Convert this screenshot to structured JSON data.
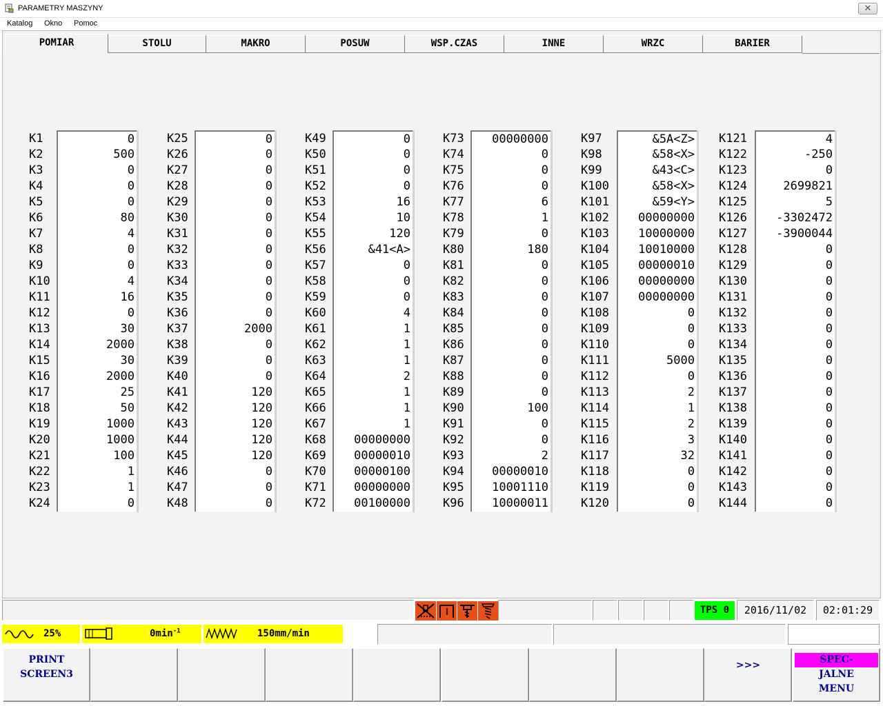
{
  "window": {
    "title": "PARAMETRY MASZYNY",
    "close_label": "✕"
  },
  "menu": [
    "Katalog",
    "Okno",
    "Pomoc"
  ],
  "tabs": [
    "POMIAR",
    "STOLU",
    "MAKRO",
    "POSUW",
    "WSP.CZAS",
    "INNE",
    "WRZC",
    "BARIER"
  ],
  "active_tab": "POMIAR",
  "params": [
    [
      {
        "k": "K1",
        "v": "0"
      },
      {
        "k": "K2",
        "v": "500"
      },
      {
        "k": "K3",
        "v": "0"
      },
      {
        "k": "K4",
        "v": "0"
      },
      {
        "k": "K5",
        "v": "0"
      },
      {
        "k": "K6",
        "v": "80"
      },
      {
        "k": "K7",
        "v": "4"
      },
      {
        "k": "K8",
        "v": "0"
      },
      {
        "k": "K9",
        "v": "0"
      },
      {
        "k": "K10",
        "v": "4"
      },
      {
        "k": "K11",
        "v": "16"
      },
      {
        "k": "K12",
        "v": "0"
      },
      {
        "k": "K13",
        "v": "30"
      },
      {
        "k": "K14",
        "v": "2000"
      },
      {
        "k": "K15",
        "v": "30"
      },
      {
        "k": "K16",
        "v": "2000"
      },
      {
        "k": "K17",
        "v": "25"
      },
      {
        "k": "K18",
        "v": "50"
      },
      {
        "k": "K19",
        "v": "1000"
      },
      {
        "k": "K20",
        "v": "1000"
      },
      {
        "k": "K21",
        "v": "100"
      },
      {
        "k": "K22",
        "v": "1"
      },
      {
        "k": "K23",
        "v": "1"
      },
      {
        "k": "K24",
        "v": "0"
      }
    ],
    [
      {
        "k": "K25",
        "v": "0"
      },
      {
        "k": "K26",
        "v": "0"
      },
      {
        "k": "K27",
        "v": "0"
      },
      {
        "k": "K28",
        "v": "0"
      },
      {
        "k": "K29",
        "v": "0"
      },
      {
        "k": "K30",
        "v": "0"
      },
      {
        "k": "K31",
        "v": "0"
      },
      {
        "k": "K32",
        "v": "0"
      },
      {
        "k": "K33",
        "v": "0"
      },
      {
        "k": "K34",
        "v": "0"
      },
      {
        "k": "K35",
        "v": "0"
      },
      {
        "k": "K36",
        "v": "0"
      },
      {
        "k": "K37",
        "v": "2000"
      },
      {
        "k": "K38",
        "v": "0"
      },
      {
        "k": "K39",
        "v": "0"
      },
      {
        "k": "K40",
        "v": "0"
      },
      {
        "k": "K41",
        "v": "120"
      },
      {
        "k": "K42",
        "v": "120"
      },
      {
        "k": "K43",
        "v": "120"
      },
      {
        "k": "K44",
        "v": "120"
      },
      {
        "k": "K45",
        "v": "120"
      },
      {
        "k": "K46",
        "v": "0"
      },
      {
        "k": "K47",
        "v": "0"
      },
      {
        "k": "K48",
        "v": "0"
      }
    ],
    [
      {
        "k": "K49",
        "v": "0"
      },
      {
        "k": "K50",
        "v": "0"
      },
      {
        "k": "K51",
        "v": "0"
      },
      {
        "k": "K52",
        "v": "0"
      },
      {
        "k": "K53",
        "v": "16"
      },
      {
        "k": "K54",
        "v": "10"
      },
      {
        "k": "K55",
        "v": "120"
      },
      {
        "k": "K56",
        "v": "&41<A>"
      },
      {
        "k": "K57",
        "v": "0"
      },
      {
        "k": "K58",
        "v": "0"
      },
      {
        "k": "K59",
        "v": "0"
      },
      {
        "k": "K60",
        "v": "4"
      },
      {
        "k": "K61",
        "v": "1"
      },
      {
        "k": "K62",
        "v": "1"
      },
      {
        "k": "K63",
        "v": "1"
      },
      {
        "k": "K64",
        "v": "2"
      },
      {
        "k": "K65",
        "v": "1"
      },
      {
        "k": "K66",
        "v": "1"
      },
      {
        "k": "K67",
        "v": "1"
      },
      {
        "k": "K68",
        "v": "00000000"
      },
      {
        "k": "K69",
        "v": "00000010"
      },
      {
        "k": "K70",
        "v": "00000100"
      },
      {
        "k": "K71",
        "v": "00000000"
      },
      {
        "k": "K72",
        "v": "00100000"
      }
    ],
    [
      {
        "k": "K73",
        "v": "00000000"
      },
      {
        "k": "K74",
        "v": "0"
      },
      {
        "k": "K75",
        "v": "0"
      },
      {
        "k": "K76",
        "v": "0"
      },
      {
        "k": "K77",
        "v": "6"
      },
      {
        "k": "K78",
        "v": "1"
      },
      {
        "k": "K79",
        "v": "0"
      },
      {
        "k": "K80",
        "v": "180"
      },
      {
        "k": "K81",
        "v": "0"
      },
      {
        "k": "K82",
        "v": "0"
      },
      {
        "k": "K83",
        "v": "0"
      },
      {
        "k": "K84",
        "v": "0"
      },
      {
        "k": "K85",
        "v": "0"
      },
      {
        "k": "K86",
        "v": "0"
      },
      {
        "k": "K87",
        "v": "0"
      },
      {
        "k": "K88",
        "v": "0"
      },
      {
        "k": "K89",
        "v": "0"
      },
      {
        "k": "K90",
        "v": "100"
      },
      {
        "k": "K91",
        "v": "0"
      },
      {
        "k": "K92",
        "v": "0"
      },
      {
        "k": "K93",
        "v": "2"
      },
      {
        "k": "K94",
        "v": "00000010"
      },
      {
        "k": "K95",
        "v": "10001110"
      },
      {
        "k": "K96",
        "v": "10000011"
      }
    ],
    [
      {
        "k": "K97",
        "v": "&5A<Z>"
      },
      {
        "k": "K98",
        "v": "&58<X>"
      },
      {
        "k": "K99",
        "v": "&43<C>"
      },
      {
        "k": "K100",
        "v": "&58<X>"
      },
      {
        "k": "K101",
        "v": "&59<Y>"
      },
      {
        "k": "K102",
        "v": "00000000"
      },
      {
        "k": "K103",
        "v": "10000000"
      },
      {
        "k": "K104",
        "v": "10010000"
      },
      {
        "k": "K105",
        "v": "00000010"
      },
      {
        "k": "K106",
        "v": "00000000"
      },
      {
        "k": "K107",
        "v": "00000000"
      },
      {
        "k": "K108",
        "v": "0"
      },
      {
        "k": "K109",
        "v": "0"
      },
      {
        "k": "K110",
        "v": "0"
      },
      {
        "k": "K111",
        "v": "5000"
      },
      {
        "k": "K112",
        "v": "0"
      },
      {
        "k": "K113",
        "v": "2"
      },
      {
        "k": "K114",
        "v": "1"
      },
      {
        "k": "K115",
        "v": "2"
      },
      {
        "k": "K116",
        "v": "3"
      },
      {
        "k": "K117",
        "v": "32"
      },
      {
        "k": "K118",
        "v": "0"
      },
      {
        "k": "K119",
        "v": "0"
      },
      {
        "k": "K120",
        "v": "0"
      }
    ],
    [
      {
        "k": "K121",
        "v": "4"
      },
      {
        "k": "K122",
        "v": "-250"
      },
      {
        "k": "K123",
        "v": "0"
      },
      {
        "k": "K124",
        "v": "2699821"
      },
      {
        "k": "K125",
        "v": "5"
      },
      {
        "k": "K126",
        "v": "-3302472"
      },
      {
        "k": "K127",
        "v": "-3900044"
      },
      {
        "k": "K128",
        "v": "0"
      },
      {
        "k": "K129",
        "v": "0"
      },
      {
        "k": "K130",
        "v": "0"
      },
      {
        "k": "K131",
        "v": "0"
      },
      {
        "k": "K132",
        "v": "0"
      },
      {
        "k": "K133",
        "v": "0"
      },
      {
        "k": "K134",
        "v": "0"
      },
      {
        "k": "K135",
        "v": "0"
      },
      {
        "k": "K136",
        "v": "0"
      },
      {
        "k": "K137",
        "v": "0"
      },
      {
        "k": "K138",
        "v": "0"
      },
      {
        "k": "K139",
        "v": "0"
      },
      {
        "k": "K140",
        "v": "0"
      },
      {
        "k": "K141",
        "v": "0"
      },
      {
        "k": "K142",
        "v": "0"
      },
      {
        "k": "K143",
        "v": "0"
      },
      {
        "k": "K144",
        "v": "0"
      }
    ]
  ],
  "status": {
    "tps_label": "TPS 0",
    "date": "2016/11/02",
    "time": "02:01:29",
    "icons": [
      "spindle-alarm-icon",
      "tool-frame-icon",
      "drill-icon",
      "screw-icon"
    ]
  },
  "feed": {
    "override": "25%",
    "spindle": "0min",
    "spindle_unit_sup": "-1",
    "feedrate": "150mm/min"
  },
  "fkeys": [
    {
      "lines": [
        "PRINT",
        "SCREEN3"
      ]
    },
    {
      "lines": []
    },
    {
      "lines": []
    },
    {
      "lines": []
    },
    {
      "lines": []
    },
    {
      "lines": []
    },
    {
      "lines": []
    },
    {
      "lines": []
    },
    {
      "lines": [
        ">>>"
      ]
    },
    {
      "lines": [
        "SPEC-",
        "JALNE",
        "MENU"
      ],
      "highlight_first": true
    }
  ],
  "colors": {
    "status_yellow": "#ffff00",
    "tps_green": "#00ff00",
    "icon_orange": "#e8501a",
    "fkey_text": "#00008b",
    "spec_magenta": "#ff00ff"
  }
}
